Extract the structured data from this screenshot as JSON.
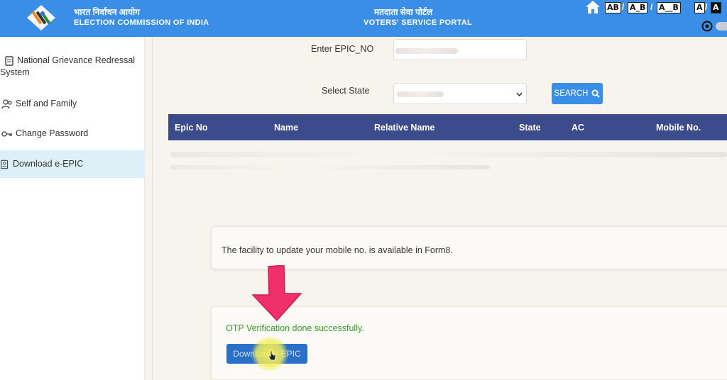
{
  "header": {
    "org_hindi": "भारत निर्वाचन आयोग",
    "org_english": "ELECTION COMMISSION OF INDIA",
    "portal_hindi": "मतदाता सेवा पोर्टल",
    "portal_english": "VOTERS' SERVICE PORTAL",
    "font_sizes": [
      "AB",
      "A_B",
      "A__B",
      "A",
      "A"
    ]
  },
  "sidebar": {
    "items": [
      {
        "label_line1": "National Grievance Redressal",
        "label_line2": "System",
        "icon": "document-icon"
      },
      {
        "label": "Self and Family",
        "icon": "users-icon"
      },
      {
        "label": "Change Password",
        "icon": "key-icon"
      },
      {
        "label": "Download e-EPIC",
        "icon": "card-icon",
        "active": true
      }
    ]
  },
  "form": {
    "epic_label": "Enter EPIC_NO",
    "state_label": "Select State",
    "search_label": "SEARCH"
  },
  "table": {
    "columns": [
      "Epic No",
      "Name",
      "Relative Name",
      "State",
      "AC",
      "Mobile No."
    ]
  },
  "notice": {
    "text": "The facility to update your mobile no. is available in Form8."
  },
  "otp": {
    "status_text": "OTP Verification done successfully.",
    "download_label": "Download e-EPIC"
  },
  "colors": {
    "header_bg": "#3a8ee6",
    "table_header_bg": "#3c4b8c",
    "success_text": "#3a9a2a",
    "button_bg": "#2a6fc8",
    "arrow": "#f0306a"
  }
}
